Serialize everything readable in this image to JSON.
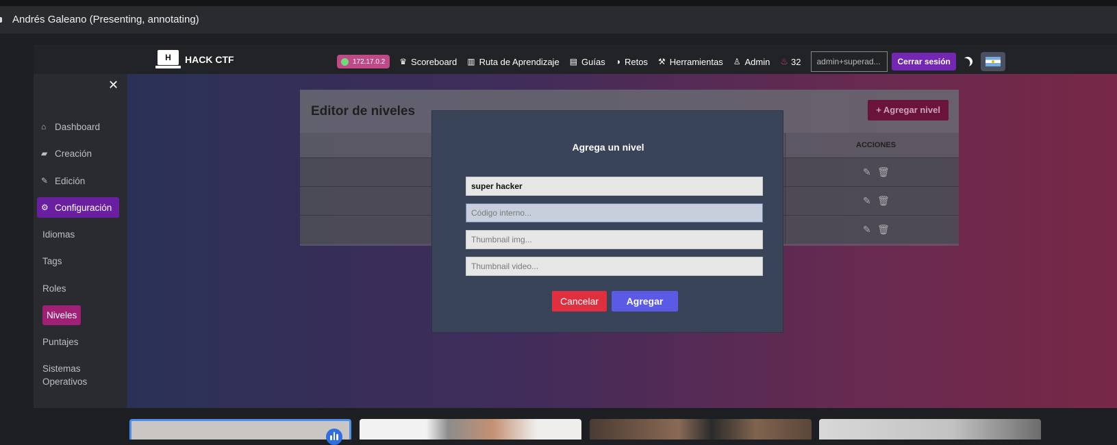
{
  "presenter": {
    "label": "Andrés Galeano (Presenting, annotating)"
  },
  "navbar": {
    "brand": "HACK CTF",
    "logo_letter": "H",
    "ip": "172.17.0.2",
    "links": [
      "Scoreboard",
      "Ruta de Aprendizaje",
      "Guías",
      "Retos",
      "Herramientas",
      "Admin"
    ],
    "points": "32",
    "user": "admin+superad...",
    "logout": "Cerrar sesión",
    "colors": {
      "ip_pill": "#c04a87",
      "logout": "#7427b3"
    }
  },
  "sidebar": {
    "close": "✕",
    "items": [
      {
        "label": "Dashboard",
        "icon": "home-icon"
      },
      {
        "label": "Creación",
        "icon": "folder-plus-icon"
      },
      {
        "label": "Edición",
        "icon": "edit-icon"
      },
      {
        "label": "Configuración",
        "icon": "gear-icon"
      }
    ],
    "subitems": [
      "Idiomas",
      "Tags",
      "Roles",
      "Niveles",
      "Puntajes",
      "Sistemas Operativos"
    ],
    "active_item": "Configuración",
    "active_subitem": "Niveles"
  },
  "editor": {
    "title": "Editor de niveles",
    "add_button": "+ Agregar nivel",
    "actions_header": "ACCIONES"
  },
  "modal": {
    "title": "Agrega un nivel",
    "name_value": "super hacker",
    "code_placeholder": "Código interno...",
    "thumb_img_placeholder": "Thumbnail img...",
    "thumb_video_placeholder": "Thumbnail video...",
    "cancel": "Cancelar",
    "submit": "Agregar",
    "colors": {
      "cancel": "#e0303f",
      "submit": "#5a5ae6"
    }
  }
}
